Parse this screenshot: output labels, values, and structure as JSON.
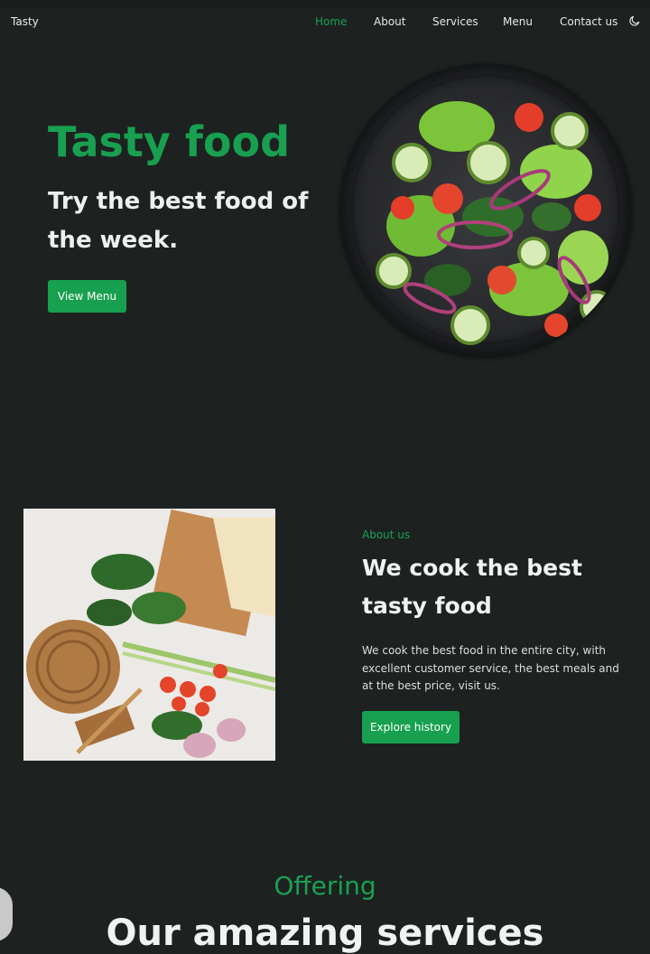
{
  "header": {
    "logo": "Tasty",
    "nav": [
      "Home",
      "About",
      "Services",
      "Menu",
      "Contact us"
    ],
    "active": "Home",
    "theme_icon": "moon-icon"
  },
  "hero": {
    "title": "Tasty food",
    "subtitle": "Try the best food of the week.",
    "button": "View Menu"
  },
  "about": {
    "kicker": "About us",
    "title": "We cook the best tasty food",
    "text": "We cook the best food in the entire city, with excellent customer service, the best meals and at the best price, visit us.",
    "button": "Explore history"
  },
  "offering": {
    "kicker": "Offering",
    "title": "Our amazing services"
  },
  "colors": {
    "accent": "#18a050",
    "background": "#1d2221",
    "text": "#eef0ee"
  }
}
